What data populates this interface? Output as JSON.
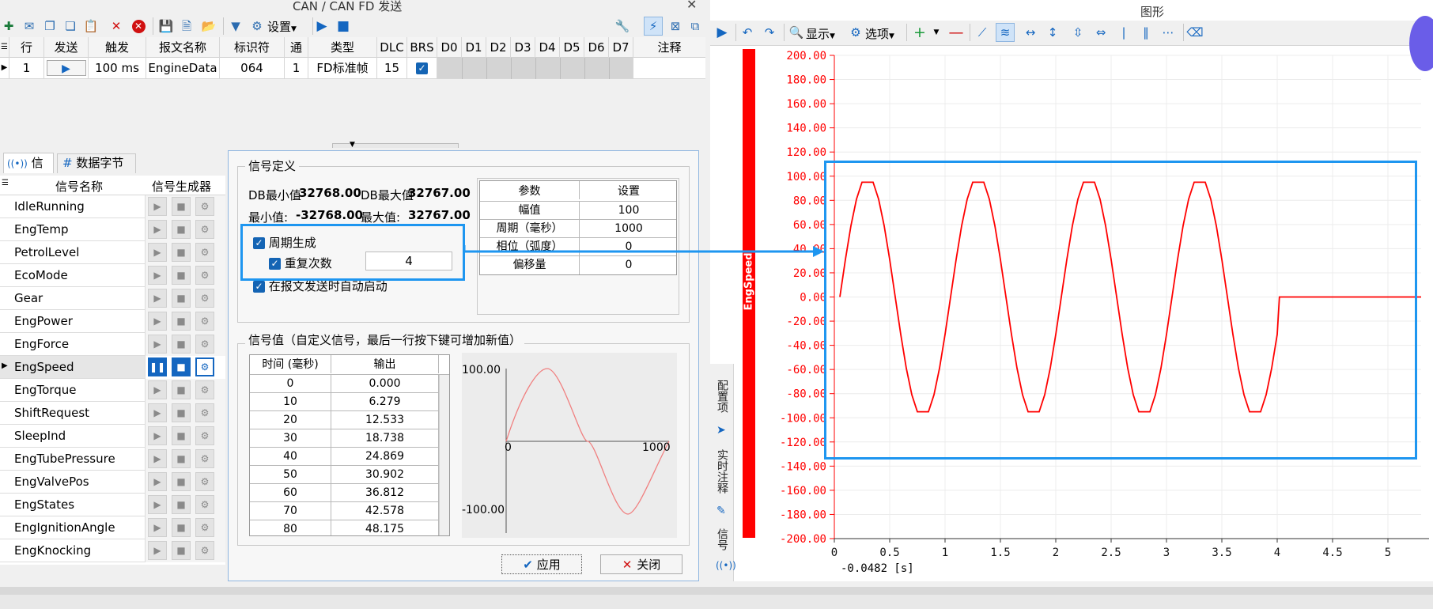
{
  "window_title": "CAN / CAN FD 发送",
  "toolbar": {
    "settings_label": "设置"
  },
  "message_grid": {
    "headers": [
      "行",
      "发送",
      "触发",
      "报文名称",
      "标识符",
      "通道",
      "类型",
      "DLC",
      "BRS",
      "D0",
      "D1",
      "D2",
      "D3",
      "D4",
      "D5",
      "D6",
      "D7",
      "注释"
    ],
    "row": {
      "line": "1",
      "trigger": "100 ms",
      "name": "EngineData",
      "identifier": "064",
      "channel": "1",
      "type": "FD标准帧",
      "dlc": "15"
    }
  },
  "lower_tabs": {
    "signal": "信号",
    "data_bytes": "数据字节"
  },
  "signal_list": {
    "header_name": "信号名称",
    "header_generator": "信号生成器",
    "items": [
      "IdleRunning",
      "EngTemp",
      "PetrolLevel",
      "EcoMode",
      "Gear",
      "EngPower",
      "EngForce",
      "EngSpeed",
      "EngTorque",
      "ShiftRequest",
      "SleepInd",
      "EngTubePressure",
      "EngValvePos",
      "EngStates",
      "EngIgnitionAngle",
      "EngKnocking"
    ],
    "selected": "EngSpeed"
  },
  "dialog": {
    "group_title": "信号定义",
    "db_min_label": "DB最小值",
    "db_min_value": "32768.00",
    "db_max_label": "DB最大值",
    "db_max_value": "32767.00",
    "min_label": "最小值:",
    "min_value": "-32768.00",
    "max_label": "最大值:",
    "max_value": "32767.00",
    "periodic_label": "周期生成",
    "repeat_label": "重复次数",
    "repeat_value": "4",
    "autostart_label": "在报文发送时自动启动",
    "param_header": "参数",
    "setting_header": "设置",
    "params": [
      {
        "name": "幅值",
        "value": "100"
      },
      {
        "name": "周期（毫秒）",
        "value": "1000"
      },
      {
        "name": "相位（弧度）",
        "value": "0"
      },
      {
        "name": "偏移量",
        "value": "0"
      }
    ],
    "values_group_title": "信号值（自定义信号，最后一行按下键可增加新值）",
    "values_header_time": "时间 (毫秒)",
    "values_header_output": "输出",
    "values": [
      {
        "t": "0",
        "v": "0.000"
      },
      {
        "t": "10",
        "v": "6.279"
      },
      {
        "t": "20",
        "v": "12.533"
      },
      {
        "t": "30",
        "v": "18.738"
      },
      {
        "t": "40",
        "v": "24.869"
      },
      {
        "t": "50",
        "v": "30.902"
      },
      {
        "t": "60",
        "v": "36.812"
      },
      {
        "t": "70",
        "v": "42.578"
      },
      {
        "t": "80",
        "v": "48.175"
      }
    ],
    "preview": {
      "ymax": "100.00",
      "ymin": "-100.00",
      "x0": "0",
      "x1": "1000"
    },
    "apply_label": "应用",
    "close_label": "关闭"
  },
  "graph": {
    "title": "图形",
    "display_label": "显示",
    "options_label": "选项",
    "signal_axis_label": "EngSpeed",
    "cursor_readout": "-0.0482 [s]",
    "side_tabs": [
      "配置项",
      "实时注释",
      "信号"
    ],
    "chart_data": {
      "type": "line",
      "title": "",
      "xlabel": "",
      "ylabel": "EngSpeed",
      "xlim": [
        0,
        5.3
      ],
      "ylim": [
        -200,
        200
      ],
      "x_ticks": [
        "0",
        "0.5",
        "1",
        "1.5",
        "2",
        "2.5",
        "3",
        "3.5",
        "4",
        "4.5",
        "5"
      ],
      "y_ticks": [
        "200.00",
        "180.00",
        "160.00",
        "140.00",
        "120.00",
        "100.00",
        "80.00",
        "60.00",
        "40.00",
        "20.00",
        "0.00",
        "-20.00",
        "-40.00",
        "-60.00",
        "-80.00",
        "-100.00",
        "-120.00",
        "-140.00",
        "-160.00",
        "-180.00",
        "-200.00"
      ],
      "series": [
        {
          "color": "#ff0000",
          "x": [
            0.05,
            0.1,
            0.15,
            0.2,
            0.25,
            0.35,
            0.4,
            0.45,
            0.5,
            0.55,
            0.6,
            0.65,
            0.7,
            0.75,
            0.85,
            0.9,
            0.95,
            1.0,
            1.05,
            1.1,
            1.15,
            1.2,
            1.25,
            1.35,
            1.4,
            1.45,
            1.5,
            1.55,
            1.6,
            1.65,
            1.7,
            1.75,
            1.85,
            1.9,
            1.95,
            2.0,
            2.05,
            2.1,
            2.15,
            2.2,
            2.25,
            2.35,
            2.4,
            2.45,
            2.5,
            2.55,
            2.6,
            2.65,
            2.7,
            2.75,
            2.85,
            2.9,
            2.95,
            3.0,
            3.05,
            3.1,
            3.15,
            3.2,
            3.25,
            3.35,
            3.4,
            3.45,
            3.5,
            3.55,
            3.6,
            3.65,
            3.7,
            3.75,
            3.85,
            3.9,
            3.95,
            4.0,
            4.02,
            5.3
          ],
          "y": [
            0,
            31,
            59,
            81,
            95,
            95,
            81,
            59,
            31,
            0,
            -31,
            -59,
            -81,
            -95,
            -95,
            -81,
            -59,
            -31,
            0,
            31,
            59,
            81,
            95,
            95,
            81,
            59,
            31,
            0,
            -31,
            -59,
            -81,
            -95,
            -95,
            -81,
            -59,
            -31,
            0,
            31,
            59,
            81,
            95,
            95,
            81,
            59,
            31,
            0,
            -31,
            -59,
            -81,
            -95,
            -95,
            -81,
            -59,
            -31,
            0,
            31,
            59,
            81,
            95,
            95,
            81,
            59,
            31,
            0,
            -31,
            -59,
            -81,
            -95,
            -95,
            -81,
            -59,
            -31,
            0,
            0
          ]
        }
      ]
    }
  }
}
